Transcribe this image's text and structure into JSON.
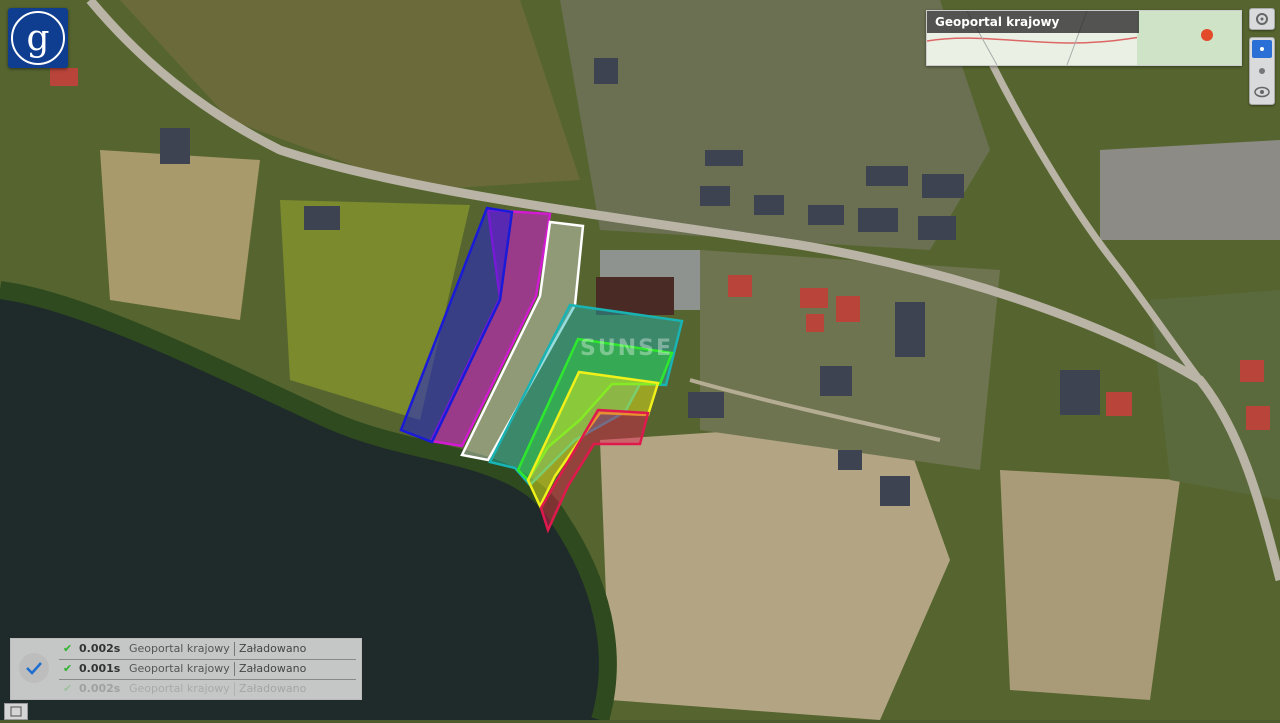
{
  "app": {
    "logo_letter": "g"
  },
  "minimap": {
    "title": "Geoportal krajowy"
  },
  "watermark": {
    "text": "SUNSE"
  },
  "plot_colors": {
    "blue": "#1a1ad9",
    "magenta": "#d21ad2",
    "white": "#ffffff",
    "teal": "#1ab3b3",
    "green": "#2ee82e",
    "yellow": "#f0f01a",
    "red": "#e0194d"
  },
  "icons": {
    "logo": "geoportal-logo-icon",
    "settings": "settings-icon",
    "zoom_in": "zoom-in-icon",
    "view": "eye-icon",
    "loaded": "checkmark-icon",
    "toggle": "panel-toggle-icon"
  },
  "layers": [
    {
      "time": "0.002s",
      "name": "Geoportal krajowy",
      "status": "Załadowano"
    },
    {
      "time": "0.001s",
      "name": "Geoportal krajowy",
      "status": "Załadowano"
    },
    {
      "time": "0.002s",
      "name": "Geoportal krajowy",
      "status": "Załadowano"
    }
  ]
}
